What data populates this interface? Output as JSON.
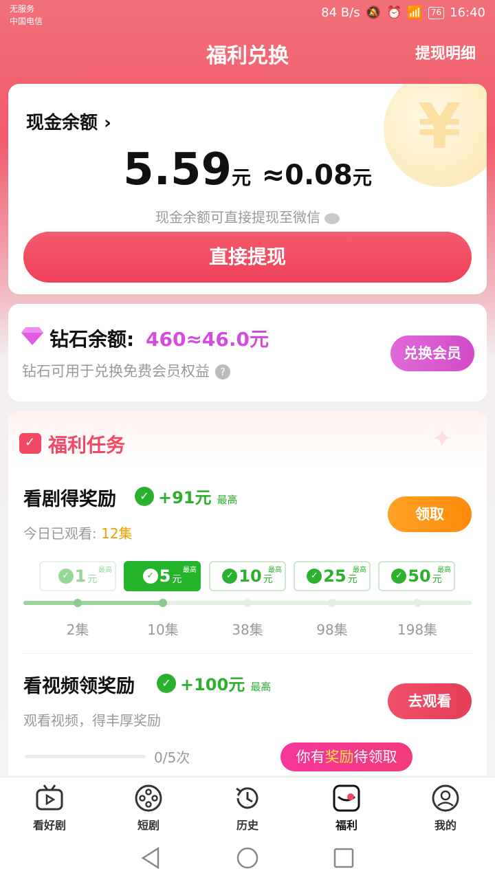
{
  "status_bar": {
    "carrier_line1": "无服务",
    "carrier_line2": "中国电信",
    "net_speed": "84 B/s",
    "battery": "76",
    "time": "16:40"
  },
  "header": {
    "title": "福利兑换",
    "right_link": "提现明细"
  },
  "cash": {
    "label": "现金余额",
    "amount": "5.59",
    "unit": "元",
    "approx": "≈0.08",
    "approx_unit": "元",
    "hint": "现金余额可直接提现至微信",
    "button": "直接提现"
  },
  "diamond": {
    "label": "钻石余额:",
    "value": "460≈46.0元",
    "hint": "钻石可用于兑换免费会员权益",
    "button": "兑换会员"
  },
  "tasks": {
    "title": "福利任务",
    "task1": {
      "title": "看剧得奖励",
      "reward": "+91元",
      "reward_max": "最高",
      "sub_prefix": "今日已观看: ",
      "sub_value": "12集",
      "button": "领取",
      "milestones": [
        {
          "amount": "1",
          "unit": "元",
          "max": "最高",
          "episodes": "2集",
          "state": "faded"
        },
        {
          "amount": "5",
          "unit": "元",
          "max": "最高",
          "episodes": "10集",
          "state": "active"
        },
        {
          "amount": "10",
          "unit": "元",
          "max": "最高",
          "episodes": "38集",
          "state": "normal"
        },
        {
          "amount": "25",
          "unit": "元",
          "max": "最高",
          "episodes": "98集",
          "state": "normal"
        },
        {
          "amount": "50",
          "unit": "元",
          "max": "最高",
          "episodes": "198集",
          "state": "normal"
        }
      ]
    },
    "task2": {
      "title": "看视频领奖励",
      "reward": "+100元",
      "reward_max": "最高",
      "sub": "观看视频，得丰厚奖励",
      "button": "去观看",
      "progress": "0/5次"
    }
  },
  "tooltip": {
    "prefix": "你有",
    "highlight": "奖励",
    "suffix": "待领取"
  },
  "tabbar": [
    {
      "label": "看好剧",
      "icon": "tv-icon"
    },
    {
      "label": "短剧",
      "icon": "film-reel-icon"
    },
    {
      "label": "历史",
      "icon": "history-icon"
    },
    {
      "label": "福利",
      "icon": "gift-icon"
    },
    {
      "label": "我的",
      "icon": "profile-icon"
    }
  ],
  "colors": {
    "primary": "#ee3f58",
    "diamond": "#d44cde",
    "green": "#2cb12f",
    "orange": "#ff8a0a"
  }
}
